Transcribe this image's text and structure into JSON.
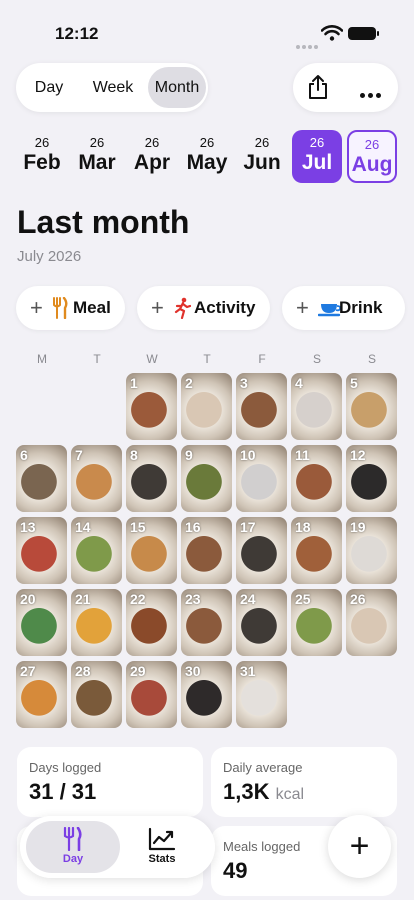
{
  "status_bar": {
    "time": "12:12"
  },
  "segmented": {
    "options": [
      "Day",
      "Week",
      "Month"
    ],
    "selected": "Month"
  },
  "months": [
    {
      "year": "26",
      "month": "Feb"
    },
    {
      "year": "26",
      "month": "Mar"
    },
    {
      "year": "26",
      "month": "Apr"
    },
    {
      "year": "26",
      "month": "May"
    },
    {
      "year": "26",
      "month": "Jun"
    },
    {
      "year": "26",
      "month": "Jul"
    },
    {
      "year": "26",
      "month": "Aug"
    }
  ],
  "header": {
    "title": "Last month",
    "subtitle": "July 2026"
  },
  "quick_add": [
    {
      "label": "Meal",
      "icon": "fork-knife-icon"
    },
    {
      "label": "Activity",
      "icon": "runner-icon"
    },
    {
      "label": "Drink",
      "icon": "cup-icon"
    }
  ],
  "weekdays": [
    "M",
    "T",
    "W",
    "T",
    "F",
    "S",
    "S"
  ],
  "calendar": {
    "days": [
      "1",
      "2",
      "3",
      "4",
      "5",
      "6",
      "7",
      "8",
      "9",
      "10",
      "11",
      "12",
      "13",
      "14",
      "15",
      "16",
      "17",
      "18",
      "19",
      "20",
      "21",
      "22",
      "23",
      "24",
      "25",
      "26",
      "27",
      "28",
      "29",
      "30",
      "31"
    ],
    "photo_colors": [
      "#9b5a3a",
      "#d9c7b4",
      "#8b5a3c",
      "#d6d0cc",
      "#c89f6a",
      "#7a6550",
      "#c98a4c",
      "#3f3a36",
      "#6a7a3a",
      "#d1cfcf",
      "#9a5a3a",
      "#2c2a2a",
      "#b84a3a",
      "#7f9a4a",
      "#c78a4a",
      "#8b5a3c",
      "#3f3a36",
      "#a0603a",
      "#dedad6",
      "#4f8a4a",
      "#e2a23a",
      "#8a4a2a",
      "#8b5a3c",
      "#3f3a36",
      "#7f9a4a",
      "#d9c7b4",
      "#d68a3a",
      "#7a5a3a",
      "#a84a3a",
      "#2e2a2a",
      "#e4e0dc"
    ]
  },
  "stats": {
    "days_logged_label": "Days logged",
    "days_logged_value": "31 / 31",
    "daily_average_label": "Daily average",
    "daily_average_value": "1,3K",
    "daily_average_unit": "kcal",
    "meals_logged_label": "Meals logged",
    "meals_logged_value": "49"
  },
  "tabbar": {
    "tabs": [
      "Day",
      "Stats"
    ],
    "active": "Day"
  },
  "colors": {
    "accent": "#7b3fe4",
    "background": "#f2f1f6"
  }
}
